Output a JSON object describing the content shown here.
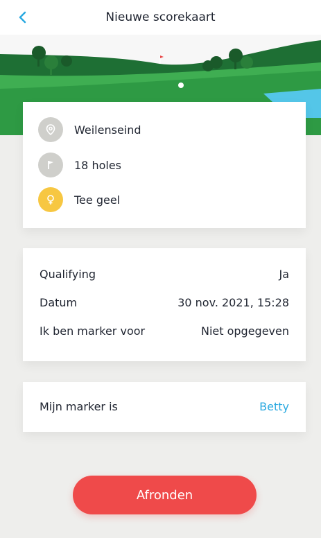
{
  "header": {
    "title": "Nieuwe scorekaart",
    "back_icon": "chevron-left-icon"
  },
  "course": {
    "location": "Weilenseind",
    "holes": "18 holes",
    "tee": "Tee geel",
    "location_icon": "map-pin-icon",
    "holes_icon": "flag-icon",
    "tee_icon": "tee-female-icon",
    "tee_color": "#f7c742"
  },
  "details": {
    "qualifying_label": "Qualifying",
    "qualifying_value": "Ja",
    "datum_label": "Datum",
    "datum_value": "30 nov. 2021, 15:28",
    "marker_for_label": "Ik ben marker voor",
    "marker_for_value": "Niet opgegeven"
  },
  "marker": {
    "label": "Mijn marker is",
    "value": "Betty"
  },
  "actions": {
    "finish_label": "Afronden"
  },
  "colors": {
    "accent_blue": "#2aa9e0",
    "cta_red": "#ef4a4a",
    "grass_green": "#2e9a44",
    "dark_green": "#1e6f34"
  }
}
